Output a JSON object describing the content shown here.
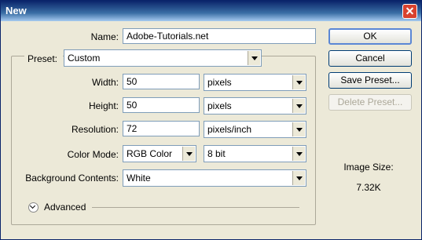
{
  "window": {
    "title": "New"
  },
  "fields": {
    "name_label": "Name:",
    "name_value": "Adobe-Tutorials.net",
    "preset_label": "Preset:",
    "preset_value": "Custom",
    "width_label": "Width:",
    "width_value": "50",
    "width_unit": "pixels",
    "height_label": "Height:",
    "height_value": "50",
    "height_unit": "pixels",
    "resolution_label": "Resolution:",
    "resolution_value": "72",
    "resolution_unit": "pixels/inch",
    "color_mode_label": "Color Mode:",
    "color_mode_value": "RGB Color",
    "bit_depth_value": "8 bit",
    "background_label": "Background Contents:",
    "background_value": "White",
    "advanced_label": "Advanced"
  },
  "buttons": {
    "ok": "OK",
    "cancel": "Cancel",
    "save_preset": "Save Preset...",
    "delete_preset": "Delete Preset..."
  },
  "image_size": {
    "label": "Image Size:",
    "value": "7.32K"
  }
}
